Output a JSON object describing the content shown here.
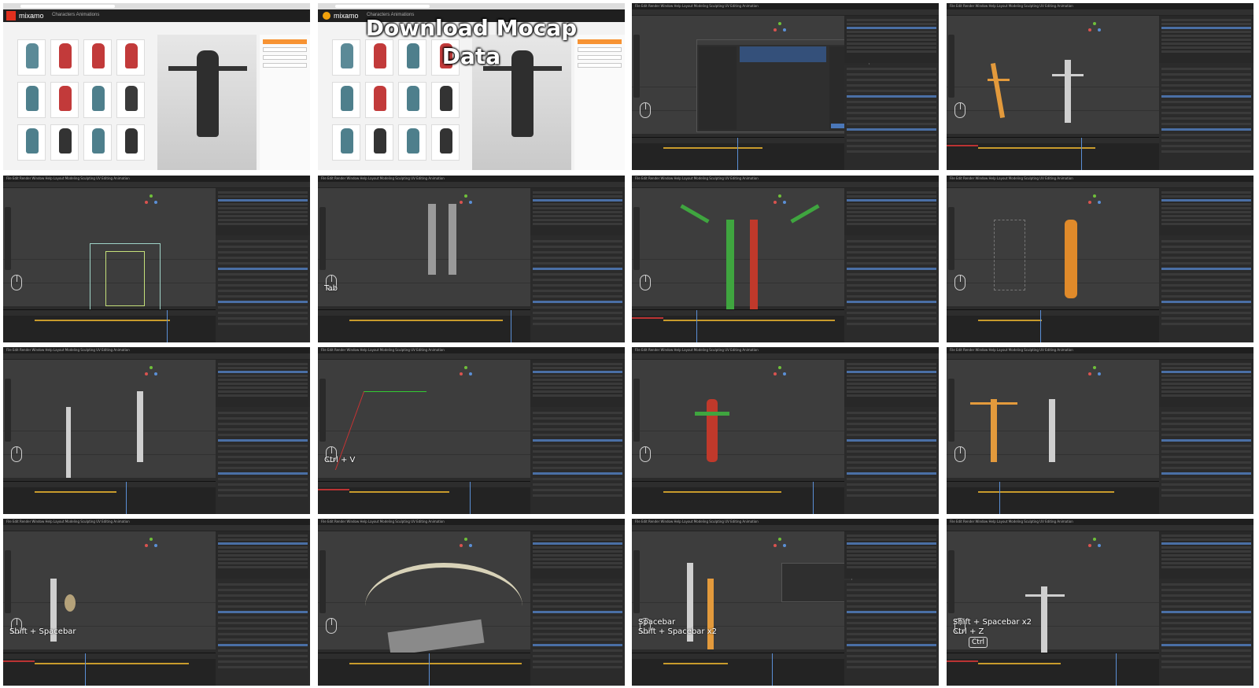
{
  "browser": {
    "app_name": "mixamo",
    "nav": "Characters   Animations"
  },
  "tiles": [
    {
      "id": "t1",
      "kind": "mixamo"
    },
    {
      "id": "t2",
      "kind": "mixamo",
      "overlay": "Download Mocap\nData"
    },
    {
      "id": "t3",
      "kind": "blender",
      "variant": "import-dialog"
    },
    {
      "id": "t4",
      "kind": "blender",
      "variant": "two-skeletons"
    },
    {
      "id": "t5",
      "kind": "blender",
      "variant": "rig"
    },
    {
      "id": "t6",
      "kind": "blender",
      "variant": "legs",
      "hotkey": "Tab"
    },
    {
      "id": "t7",
      "kind": "blender",
      "variant": "green-bones"
    },
    {
      "id": "t8",
      "kind": "blender",
      "variant": "orange-char"
    },
    {
      "id": "t9",
      "kind": "blender",
      "variant": "skeletons-list"
    },
    {
      "id": "t10",
      "kind": "blender",
      "variant": "red-green-lines",
      "hotkey": "Ctrl + V"
    },
    {
      "id": "t11",
      "kind": "blender",
      "variant": "red-char"
    },
    {
      "id": "t12",
      "kind": "blender",
      "variant": "orange-tpose"
    },
    {
      "id": "t13",
      "kind": "blender",
      "variant": "skeleton-shield",
      "hotkey": "Shift + Spacebar"
    },
    {
      "id": "t14",
      "kind": "blender",
      "variant": "dragon-bones"
    },
    {
      "id": "t15",
      "kind": "blender",
      "variant": "skeleton-pair",
      "hotkey": "Spacebar\nShift + Spacebar x2"
    },
    {
      "id": "t16",
      "kind": "blender",
      "variant": "skeleton-warrior",
      "hotkey": "Shift + Spacebar x2\nCtrl + Z",
      "keycap": "Ctrl"
    }
  ],
  "blender": {
    "menu": "File  Edit  Render  Window  Help   Layout  Modeling  Sculpting  UV Editing  Animation"
  },
  "colors": {
    "mixamo_orange": "#f79333",
    "blender_select": "#4a6fa5",
    "keyframe": "#c89b2c"
  }
}
